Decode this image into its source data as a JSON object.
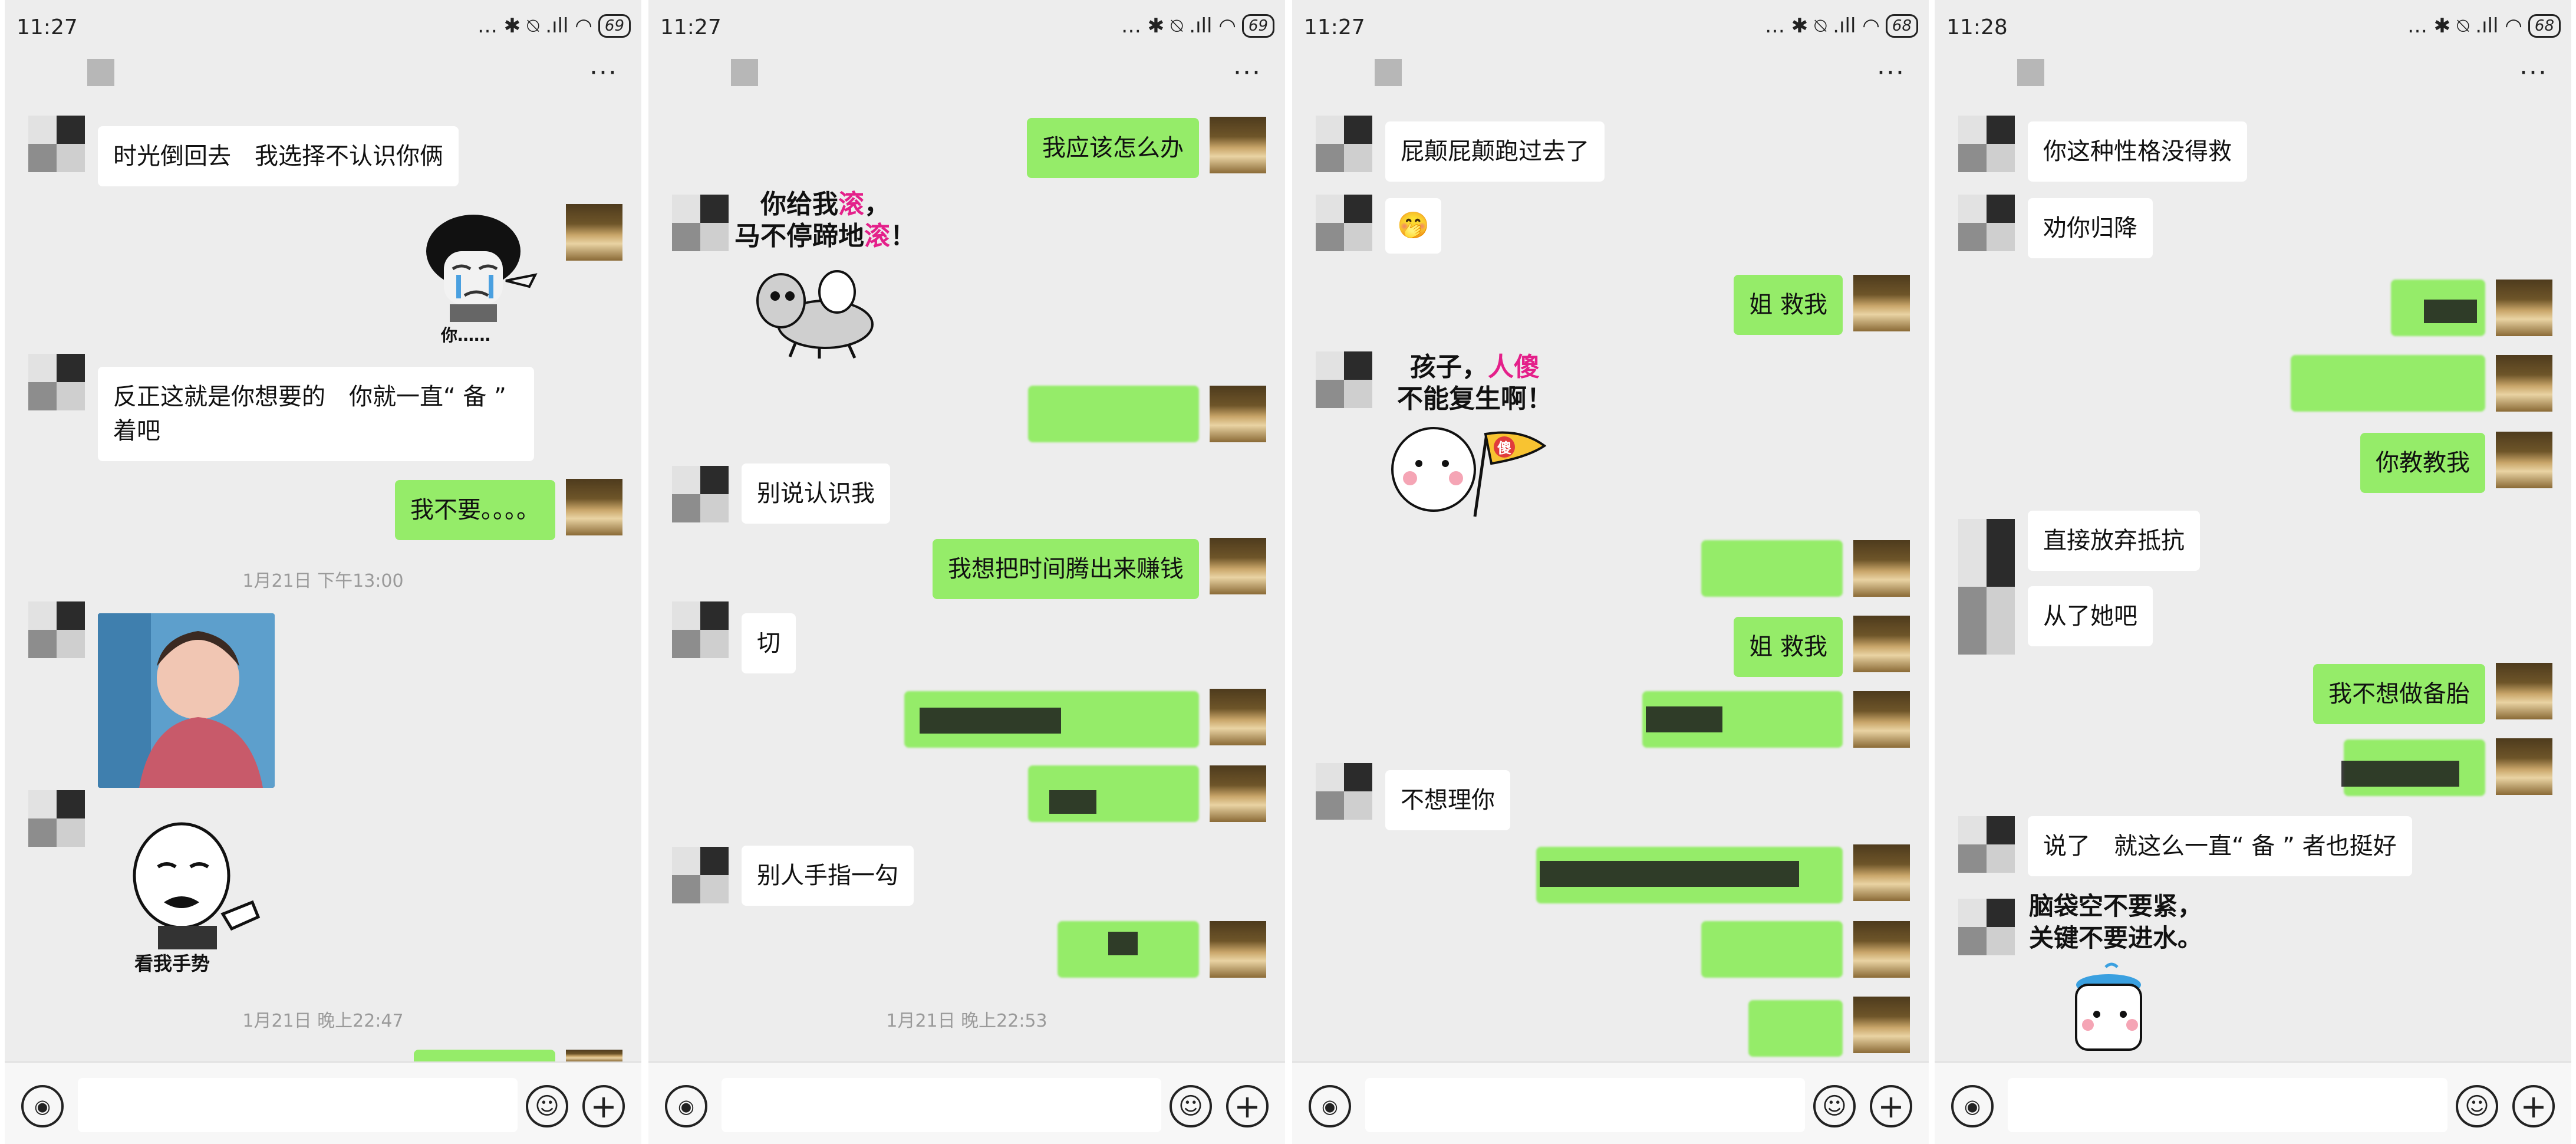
{
  "screens": [
    {
      "status": {
        "time": "11:27",
        "battery": "69"
      },
      "messages": {
        "m1": "时光倒回去　我选择不认识你俩",
        "m2": "反正这就是你想要的　你就一直“ 备 ” 着吧",
        "m3": "我不要。。。。",
        "ts1": "1月21日 下午13:00",
        "ts2": "1月21日 晚上22:47"
      },
      "stickers": {
        "s1_caption": "你……",
        "s2_caption": "看我手势"
      }
    },
    {
      "status": {
        "time": "11:27",
        "battery": "69"
      },
      "messages": {
        "m1": "我应该怎么办",
        "m2": "别说认识我",
        "m3": "我想把时间腾出来赚钱",
        "m4": "切",
        "m5": "别人手指一勾",
        "ts1": "1月21日 晚上22:53"
      },
      "stickers": {
        "s1_line1_a": "你给我",
        "s1_line1_b": "滚",
        "s1_line1_c": "，",
        "s1_line2_a": "马不停蹄地",
        "s1_line2_b": "滚",
        "s1_line2_c": "！"
      }
    },
    {
      "status": {
        "time": "11:27",
        "battery": "68"
      },
      "messages": {
        "m1": "屁颠屁颠跑过去了",
        "m2": "姐 救我",
        "m3": "姐 救我",
        "m4": "不想理你"
      },
      "stickers": {
        "s1_line1_a": "孩子，",
        "s1_line1_b": "人傻",
        "s1_line2": "不能复生啊！",
        "flag": "傻"
      }
    },
    {
      "status": {
        "time": "11:28",
        "battery": "68"
      },
      "messages": {
        "m1": "你这种性格没得救",
        "m2": "劝你归降",
        "m3": "你教教我",
        "m4": "直接放弃抵抗",
        "m5": "从了她吧",
        "m6": "我不想做备胎",
        "m7": "说了　就这么一直“ 备 ” 者也挺好"
      },
      "stickers": {
        "s1_line1": "脑袋空不要紧，",
        "s1_line2": "关键不要进水。"
      }
    }
  ],
  "icons": {
    "more": "more-icon",
    "voice": "voice-icon",
    "emoji": "emoji-icon",
    "plus": "plus-icon"
  },
  "colors": {
    "bg": "#ededed",
    "out_bubble": "#95ec69",
    "in_bubble": "#ffffff",
    "accent_pink": "#e4208a"
  }
}
